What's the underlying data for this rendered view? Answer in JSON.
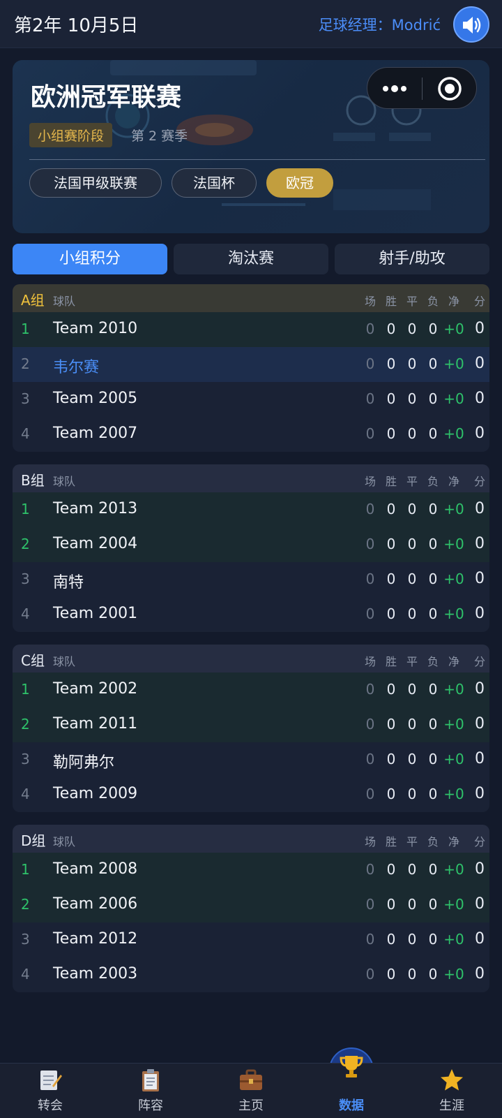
{
  "header": {
    "date": "第2年 10月5日",
    "manager": "足球经理：Modrić"
  },
  "hero": {
    "title": "欧洲冠军联赛",
    "stage": "小组赛阶段",
    "season": "第 2 赛季",
    "competitions": [
      {
        "label": "法国甲级联赛",
        "active": false
      },
      {
        "label": "法国杯",
        "active": false
      },
      {
        "label": "欧冠",
        "active": true
      }
    ]
  },
  "view_tabs": [
    {
      "label": "小组积分",
      "active": true
    },
    {
      "label": "淘汰赛",
      "active": false
    },
    {
      "label": "射手/助攻",
      "active": false
    }
  ],
  "columns": {
    "team": "球队",
    "played": "场",
    "won": "胜",
    "draw": "平",
    "lost": "负",
    "gd": "净",
    "pts": "分"
  },
  "groups": [
    {
      "name": "A组",
      "rows": [
        {
          "rank": "1",
          "team": "Team 2010",
          "played": "0",
          "won": "0",
          "draw": "0",
          "lost": "0",
          "gd": "+0",
          "pts": "0"
        },
        {
          "rank": "2",
          "team": "韦尔赛",
          "played": "0",
          "won": "0",
          "draw": "0",
          "lost": "0",
          "gd": "+0",
          "pts": "0"
        },
        {
          "rank": "3",
          "team": "Team 2005",
          "played": "0",
          "won": "0",
          "draw": "0",
          "lost": "0",
          "gd": "+0",
          "pts": "0"
        },
        {
          "rank": "4",
          "team": "Team 2007",
          "played": "0",
          "won": "0",
          "draw": "0",
          "lost": "0",
          "gd": "+0",
          "pts": "0"
        }
      ]
    },
    {
      "name": "B组",
      "rows": [
        {
          "rank": "1",
          "team": "Team 2013",
          "played": "0",
          "won": "0",
          "draw": "0",
          "lost": "0",
          "gd": "+0",
          "pts": "0"
        },
        {
          "rank": "2",
          "team": "Team 2004",
          "played": "0",
          "won": "0",
          "draw": "0",
          "lost": "0",
          "gd": "+0",
          "pts": "0"
        },
        {
          "rank": "3",
          "team": "南特",
          "played": "0",
          "won": "0",
          "draw": "0",
          "lost": "0",
          "gd": "+0",
          "pts": "0"
        },
        {
          "rank": "4",
          "team": "Team 2001",
          "played": "0",
          "won": "0",
          "draw": "0",
          "lost": "0",
          "gd": "+0",
          "pts": "0"
        }
      ]
    },
    {
      "name": "C组",
      "rows": [
        {
          "rank": "1",
          "team": "Team 2002",
          "played": "0",
          "won": "0",
          "draw": "0",
          "lost": "0",
          "gd": "+0",
          "pts": "0"
        },
        {
          "rank": "2",
          "team": "Team 2011",
          "played": "0",
          "won": "0",
          "draw": "0",
          "lost": "0",
          "gd": "+0",
          "pts": "0"
        },
        {
          "rank": "3",
          "team": "勒阿弗尔",
          "played": "0",
          "won": "0",
          "draw": "0",
          "lost": "0",
          "gd": "+0",
          "pts": "0"
        },
        {
          "rank": "4",
          "team": "Team 2009",
          "played": "0",
          "won": "0",
          "draw": "0",
          "lost": "0",
          "gd": "+0",
          "pts": "0"
        }
      ]
    },
    {
      "name": "D组",
      "rows": [
        {
          "rank": "1",
          "team": "Team 2008",
          "played": "0",
          "won": "0",
          "draw": "0",
          "lost": "0",
          "gd": "+0",
          "pts": "0"
        },
        {
          "rank": "2",
          "team": "Team 2006",
          "played": "0",
          "won": "0",
          "draw": "0",
          "lost": "0",
          "gd": "+0",
          "pts": "0"
        },
        {
          "rank": "3",
          "team": "Team 2012",
          "played": "0",
          "won": "0",
          "draw": "0",
          "lost": "0",
          "gd": "+0",
          "pts": "0"
        },
        {
          "rank": "4",
          "team": "Team 2003",
          "played": "0",
          "won": "0",
          "draw": "0",
          "lost": "0",
          "gd": "+0",
          "pts": "0"
        }
      ]
    }
  ],
  "bottom_nav": [
    {
      "label": "转会",
      "icon": "transfer-notepad-icon",
      "active": false
    },
    {
      "label": "阵容",
      "icon": "squad-clipboard-icon",
      "active": false
    },
    {
      "label": "主页",
      "icon": "briefcase-icon",
      "active": false
    },
    {
      "label": "数据",
      "icon": "trophy-icon",
      "active": true
    },
    {
      "label": "生涯",
      "icon": "star-icon",
      "active": false
    }
  ],
  "colors": {
    "accent": "#3c86f6",
    "gold": "#c29e3e",
    "qualify": "#2ec26a",
    "background": "#131a2b"
  }
}
